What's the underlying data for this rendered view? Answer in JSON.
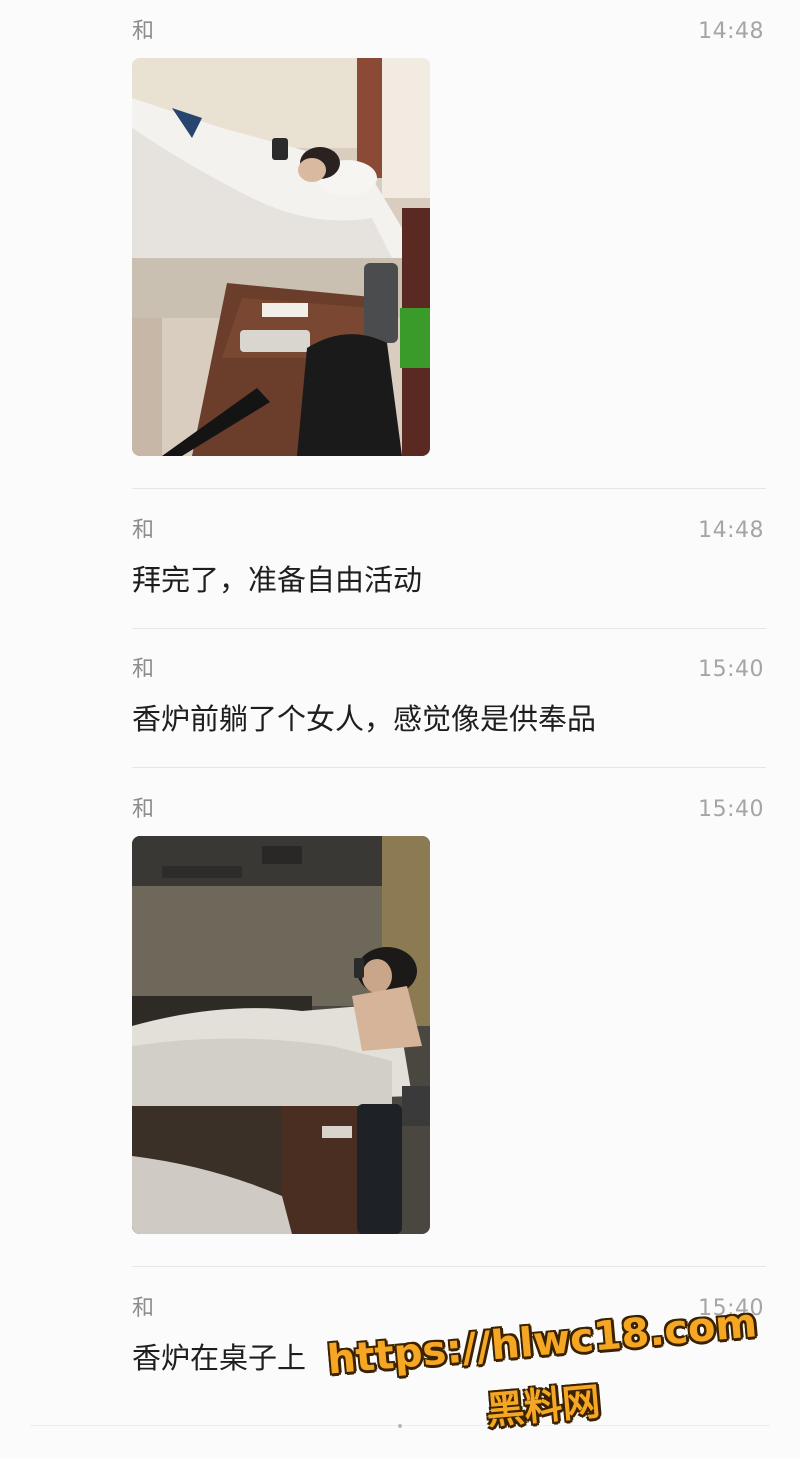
{
  "messages": [
    {
      "sender": "和",
      "time": "14:48",
      "type": "image",
      "image_desc": "hotel-bed-photo-bright"
    },
    {
      "sender": "和",
      "time": "14:48",
      "type": "text",
      "text": "拜完了，准备自由活动"
    },
    {
      "sender": "和",
      "time": "15:40",
      "type": "text",
      "text": "香炉前躺了个女人，感觉像是供奉品"
    },
    {
      "sender": "和",
      "time": "15:40",
      "type": "image",
      "image_desc": "hotel-bed-photo-dark"
    },
    {
      "sender": "和",
      "time": "15:40",
      "type": "text",
      "text": "香炉在桌子上"
    }
  ],
  "watermark": {
    "url": "https://hlwc18.com",
    "name": "黑料网"
  },
  "colors": {
    "background": "#fbfbfb",
    "sender": "#8d8d8d",
    "time": "#a5a5a5",
    "text": "#1e1e1e",
    "divider": "#e6e6e6",
    "watermark": "#f5a623"
  }
}
